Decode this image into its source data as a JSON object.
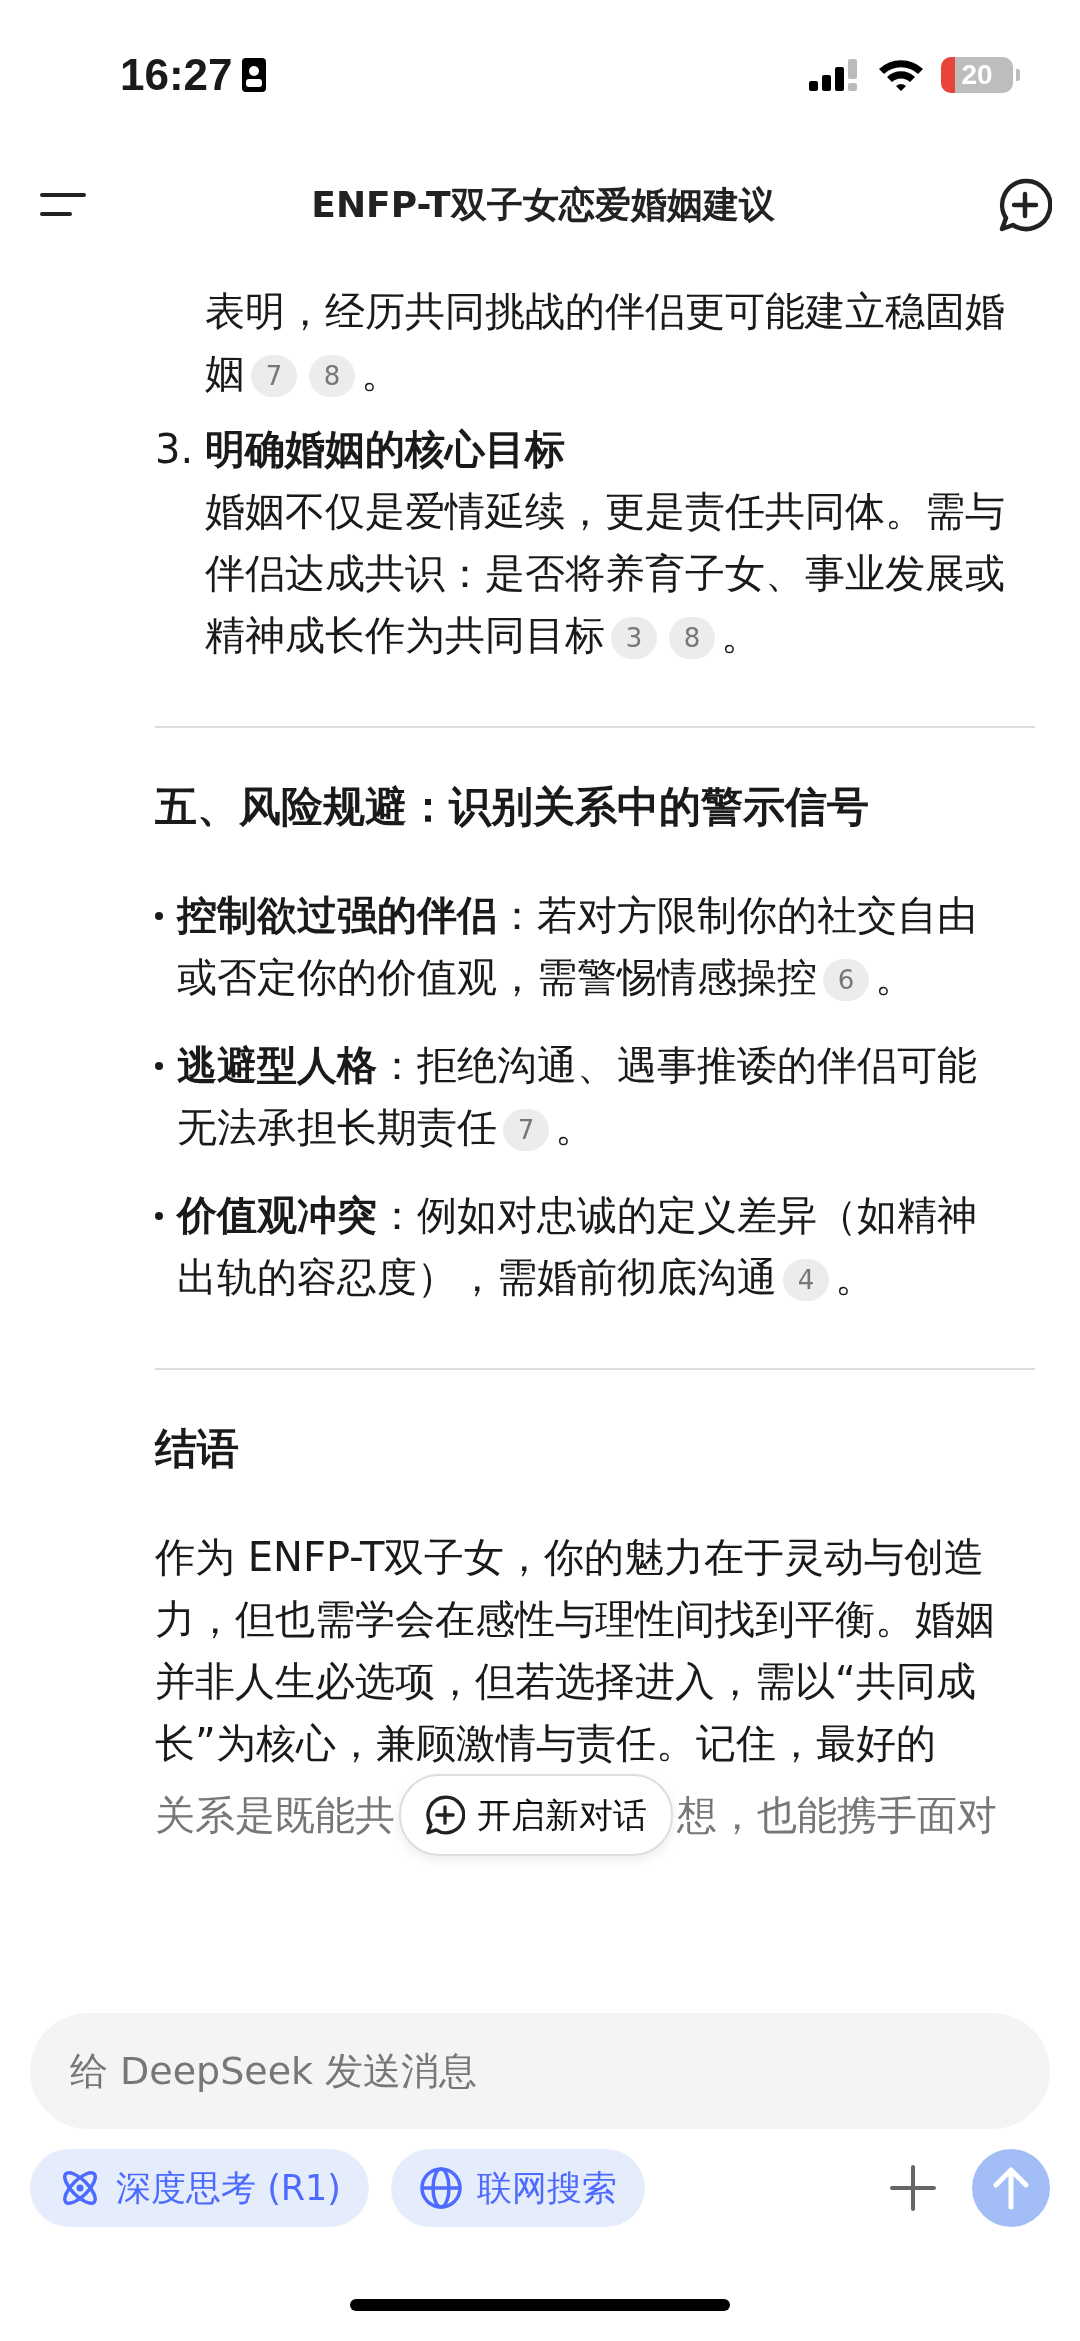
{
  "status_bar": {
    "time": "16:27",
    "battery": "20"
  },
  "header": {
    "title": "ENFP-T双子女恋爱婚姻建议"
  },
  "continued_paragraph": {
    "text": "表明，经历共同挑战的伴侣更可能建立稳固婚姻",
    "citations": [
      "7",
      "8"
    ],
    "end": "。"
  },
  "numbered_items": [
    {
      "number": "3.",
      "title": "明确婚姻的核心目标",
      "text": "婚姻不仅是爱情延续，更是责任共同体。需与伴侣达成共识：是否将养育子女、事业发展或精神成长作为共同目标",
      "citations": [
        "3",
        "8"
      ],
      "end": "。"
    }
  ],
  "sections": [
    {
      "heading": "五、风险规避：识别关系中的警示信号",
      "bullets": [
        {
          "text": "**控制欲过强的伴侣**：若对方限制你的社交自由或否定你的价值观，需警惕情感操控",
          "citations": [
            "6"
          ],
          "end": "。"
        },
        {
          "text": "**逃避型人格**：拒绝沟通、遇事推诿的伴侣可能无法承担长期责任",
          "citations": [
            "7"
          ],
          "end": "。"
        },
        {
          "text": "**价值观冲突**：例如对忠诚的定义差异（如精神出轨的容忍度），需婚前彻底沟通",
          "citations": [
            "4"
          ],
          "end": "。"
        }
      ]
    },
    {
      "heading": "结语",
      "paragraph": "作为 ENFP-T双子女，你的魅力在于灵动与创造力，但也需学会在感性与理性间找到平衡。婚姻并非人生必选项，但若选择进入，需以“共同成长”为核心，兼顾激情与责任。记住，最好的",
      "faded_line": [
        "关系是既能共",
        "想，也能携手面对"
      ]
    }
  ],
  "new_chat_button": {
    "label": "开启新对话"
  },
  "composer": {
    "placeholder": "给 DeepSeek 发送消息",
    "chips": [
      {
        "kind": "think",
        "label": "深度思考 (R1)"
      },
      {
        "kind": "search",
        "label": "联网搜索"
      }
    ]
  }
}
